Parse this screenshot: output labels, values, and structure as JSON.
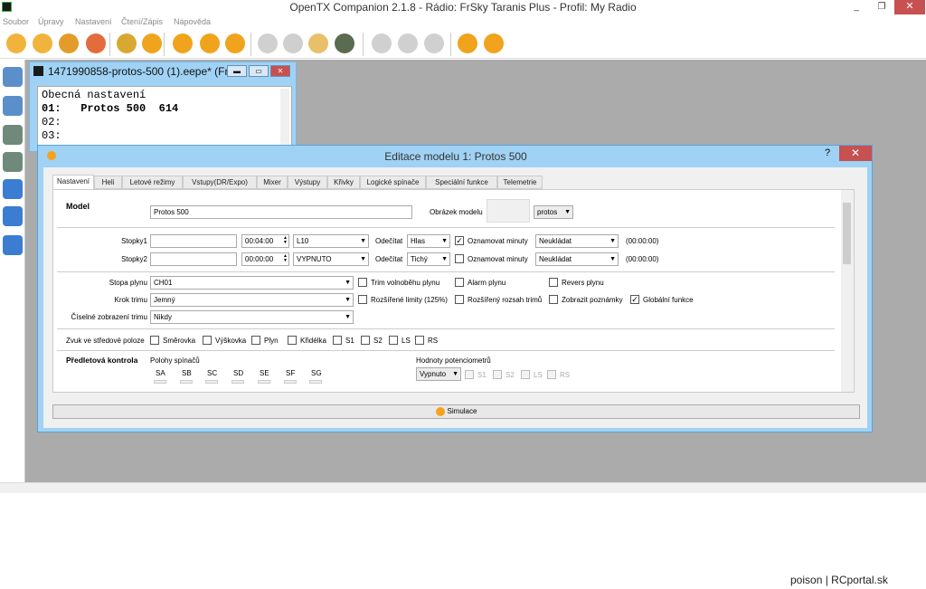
{
  "window": {
    "title": "OpenTX Companion 2.1.8 - Rádio: FrSky Taranis Plus - Profil: My Radio",
    "min": "_",
    "max": "❐",
    "close": "✕"
  },
  "menu": [
    "Soubor",
    "Úpravy",
    "Nastavení",
    "Čtení/Zápis",
    "Nápověda"
  ],
  "toolbar": {
    "icons": [
      "new-file-icon",
      "open-folder-icon",
      "recent-files-icon",
      "save-icon",
      "logs-icon",
      "download-icon",
      "preferences-icon",
      "customize-icon",
      "palette-icon",
      "simulate-icon",
      "print-icon",
      "compare-icon",
      "sd-sync-icon",
      "cut-icon",
      "copy-icon",
      "paste-icon",
      "read-radio-icon",
      "write-radio-icon"
    ]
  },
  "eepe": {
    "title": "1471990858-protos-500 (1).eepe* (Fr...",
    "heading": "Obecná nastavení",
    "lines": [
      "01:   Protos 500  614",
      "02:",
      "03:"
    ]
  },
  "dialog": {
    "title": "Editace modelu 1: Protos 500",
    "help": "?",
    "close": "✕",
    "tabs": [
      "Nastavení",
      "Heli",
      "Letové režimy",
      "Vstupy(DR/Expo)",
      "Mixer",
      "Výstupy",
      "Křivky",
      "Logické spínače",
      "Speciální funkce",
      "Telemetrie"
    ],
    "model_label": "Model",
    "model_name": "Protos 500",
    "image_label": "Obrázek modelu",
    "image_value": "protos",
    "timer1": {
      "label": "Stopky1",
      "time": "00:04:00",
      "mode": "L10",
      "countdown_label": "Odečítat",
      "countdown": "Hlas",
      "minute_label": "Oznamovat minuty",
      "minute_checked": "✓",
      "persist": "Neukládat",
      "value": "(00:00:00)"
    },
    "timer2": {
      "label": "Stopky2",
      "time": "00:00:00",
      "mode": "VYPNUTO",
      "countdown_label": "Odečítat",
      "countdown": "Tichý",
      "minute_label": "Oznamovat minuty",
      "minute_checked": "",
      "persist": "Neukládat",
      "value": "(00:00:00)"
    },
    "throttle_label": "Stopa plynu",
    "throttle_value": "CH01",
    "trim_step_label": "Krok trimu",
    "trim_step_value": "Jemný",
    "trim_display_label": "Číselné zobrazení trimu",
    "trim_display_value": "Nikdy",
    "checks_row1": [
      "Trim volnoběhu plynu",
      "Alarm plynu",
      "Revers plynu"
    ],
    "checks_row2": [
      "Rozšířené limity (125%)",
      "Rozšířený rozsah trimů",
      "Zobrazit poznámky",
      "Globální funkce"
    ],
    "global_checked": "✓",
    "center_beep_label": "Zvuk ve středové poloze",
    "center_beep": [
      "Směrovka",
      "Výškovka",
      "Plyn",
      "Křidélka",
      "S1",
      "S2",
      "LS",
      "RS"
    ],
    "preflight_label": "Předletová kontrola",
    "switch_pos_label": "Polohy spínačů",
    "switches": [
      "SA",
      "SB",
      "SC",
      "SD",
      "SE",
      "SF",
      "SG"
    ],
    "pot_label": "Hodnoty potenciometrů",
    "pot_value": "Vypnuto",
    "pots": [
      "S1",
      "S2",
      "LS",
      "RS"
    ],
    "simulate": "Simulace"
  },
  "watermark": "poison | RCportal.sk"
}
